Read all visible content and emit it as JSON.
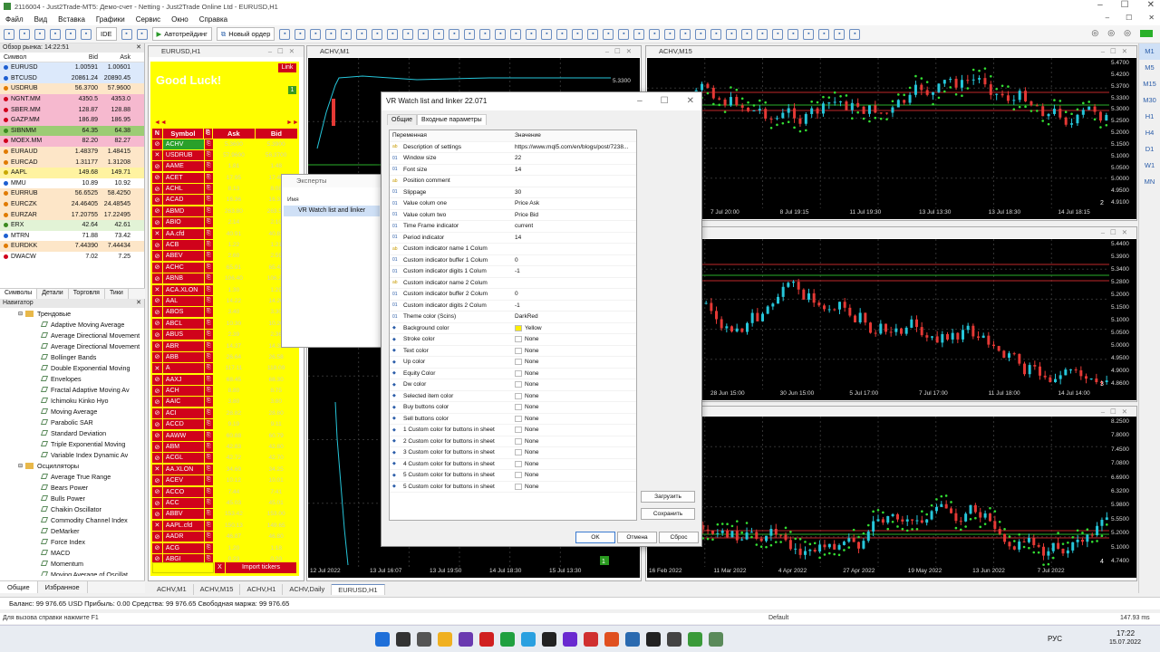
{
  "window": {
    "title": "2116004 - Just2Trade-MT5: Демо-счет - Netting - Just2Trade Online Ltd - EURUSD,H1"
  },
  "menu": [
    "Файл",
    "Вид",
    "Вставка",
    "Графики",
    "Сервис",
    "Окно",
    "Справка"
  ],
  "toolbar": {
    "ide": "IDE",
    "autotrade": "Автотрейдинг",
    "new_order": "Новый ордер"
  },
  "market_watch": {
    "title": "Обзор рынка: 14:22:51",
    "col_symbol": "Символ",
    "col_bid": "Bid",
    "col_ask": "Ask",
    "rows": [
      {
        "s": "EURUSD",
        "b": "1.00591",
        "a": "1.00601",
        "bg": "#dce9fb",
        "c": "#1d5fd1"
      },
      {
        "s": "BTCUSD",
        "b": "20861.24",
        "a": "20890.45",
        "bg": "#dce9fb",
        "c": "#1d5fd1"
      },
      {
        "s": "USDRUB",
        "b": "56.3700",
        "a": "57.9600",
        "bg": "#fde6c8",
        "c": "#e07a00"
      },
      {
        "s": "NGNT.MM",
        "b": "4350.5",
        "a": "4353.0",
        "bg": "#f6b9cf",
        "c": "#d0021b"
      },
      {
        "s": "SBER.MM",
        "b": "128.87",
        "a": "128.88",
        "bg": "#f6b9cf",
        "c": "#d0021b"
      },
      {
        "s": "GAZP.MM",
        "b": "186.89",
        "a": "186.95",
        "bg": "#f6b9cf",
        "c": "#d0021b"
      },
      {
        "s": "SIBNMM",
        "b": "64.35",
        "a": "64.38",
        "bg": "#9ccc74",
        "c": "#3a8a20"
      },
      {
        "s": "MOEX.MM",
        "b": "82.20",
        "a": "82.27",
        "bg": "#f6b9cf",
        "c": "#d0021b"
      },
      {
        "s": "EURAUD",
        "b": "1.48379",
        "a": "1.48415",
        "bg": "#fde6c8",
        "c": "#e07a00"
      },
      {
        "s": "EURCAD",
        "b": "1.31177",
        "a": "1.31208",
        "bg": "#fde6c8",
        "c": "#e07a00"
      },
      {
        "s": "AAPL",
        "b": "149.68",
        "a": "149.71",
        "bg": "#fff3a0",
        "c": "#c8a800"
      },
      {
        "s": "MMU",
        "b": "10.89",
        "a": "10.92",
        "bg": "#ffffff",
        "c": "#1d5fd1"
      },
      {
        "s": "EURRUB",
        "b": "56.6525",
        "a": "58.4250",
        "bg": "#fde6c8",
        "c": "#e07a00"
      },
      {
        "s": "EURCZK",
        "b": "24.46405",
        "a": "24.48545",
        "bg": "#fde6c8",
        "c": "#e07a00"
      },
      {
        "s": "EURZAR",
        "b": "17.20755",
        "a": "17.22495",
        "bg": "#fde6c8",
        "c": "#e07a00"
      },
      {
        "s": "ERX",
        "b": "42.64",
        "a": "42.61",
        "bg": "#e2f3d6",
        "c": "#3a8a20"
      },
      {
        "s": "MTRN",
        "b": "71.88",
        "a": "73.42",
        "bg": "#ffffff",
        "c": "#1d5fd1"
      },
      {
        "s": "EURDKK",
        "b": "7.44390",
        "a": "7.44434",
        "bg": "#fde6c8",
        "c": "#e07a00"
      },
      {
        "s": "DWACW",
        "b": "7.02",
        "a": "7.25",
        "bg": "#ffffff",
        "c": "#d0021b"
      }
    ],
    "tabs": [
      "Символы",
      "Детали",
      "Торговля",
      "Тики"
    ]
  },
  "navigator": {
    "title": "Навигатор",
    "items": [
      {
        "t": "Трендовые",
        "lvl": 1,
        "f": true
      },
      {
        "t": "Adaptive Moving Average",
        "lvl": 2
      },
      {
        "t": "Average Directional Movement",
        "lvl": 2
      },
      {
        "t": "Average Directional Movement",
        "lvl": 2
      },
      {
        "t": "Bollinger Bands",
        "lvl": 2
      },
      {
        "t": "Double Exponential Moving",
        "lvl": 2
      },
      {
        "t": "Envelopes",
        "lvl": 2
      },
      {
        "t": "Fractal Adaptive Moving Av",
        "lvl": 2
      },
      {
        "t": "Ichimoku Kinko Hyo",
        "lvl": 2
      },
      {
        "t": "Moving Average",
        "lvl": 2
      },
      {
        "t": "Parabolic SAR",
        "lvl": 2
      },
      {
        "t": "Standard Deviation",
        "lvl": 2
      },
      {
        "t": "Triple Exponential Moving",
        "lvl": 2
      },
      {
        "t": "Variable Index Dynamic Av",
        "lvl": 2
      },
      {
        "t": "Осцилляторы",
        "lvl": 1,
        "f": true
      },
      {
        "t": "Average True Range",
        "lvl": 2
      },
      {
        "t": "Bears Power",
        "lvl": 2
      },
      {
        "t": "Bulls Power",
        "lvl": 2
      },
      {
        "t": "Chaikin Oscillator",
        "lvl": 2
      },
      {
        "t": "Commodity Channel Index",
        "lvl": 2
      },
      {
        "t": "DeMarker",
        "lvl": 2
      },
      {
        "t": "Force Index",
        "lvl": 2
      },
      {
        "t": "MACD",
        "lvl": 2
      },
      {
        "t": "Momentum",
        "lvl": 2
      },
      {
        "t": "Moving Average of Oscillat",
        "lvl": 2
      }
    ],
    "tabs": [
      "Общие",
      "Избранное"
    ]
  },
  "eurusd_win": {
    "title": "EURUSD,H1",
    "good_luck": "Good Luck!",
    "link": "Link",
    "badge": "1",
    "head": [
      "N",
      "Symbol",
      "Ask",
      "Bid"
    ],
    "rows": [
      {
        "n": "⊘",
        "s": "ACHV",
        "a": "5.3600",
        "b": "5.3900",
        "sel": true
      },
      {
        "n": "✕",
        "s": "USDRUB",
        "a": "57.9600",
        "b": "56.3700"
      },
      {
        "n": "⊘",
        "s": "AAME",
        "a": "1.81",
        "b": "1.48"
      },
      {
        "n": "⊘",
        "s": "ACET",
        "a": "17.95",
        "b": "17.40"
      },
      {
        "n": "⊘",
        "s": "ACHL",
        "a": "8.13",
        "b": "8.08"
      },
      {
        "n": "⊘",
        "s": "ACAD",
        "a": "16.36",
        "b": "16.31"
      },
      {
        "n": "⊘",
        "s": "ABMD",
        "a": "263.80",
        "b": "263.50"
      },
      {
        "n": "⊘",
        "s": "ABIO",
        "a": "2.14",
        "b": "2.10"
      },
      {
        "n": "✕",
        "s": "AA.cfd",
        "a": "40.91",
        "b": "40.81"
      },
      {
        "n": "⊘",
        "s": "ACB",
        "a": "1.22",
        "b": "1.21"
      },
      {
        "n": "⊘",
        "s": "ABEV",
        "a": "2.60",
        "b": "2.59"
      },
      {
        "n": "⊘",
        "s": "ACHC",
        "a": "65.91",
        "b": "65.42"
      },
      {
        "n": "⊘",
        "s": "ABNB",
        "a": "106.40",
        "b": "106.20"
      },
      {
        "n": "✕",
        "s": "ACA.XLON",
        "a": "1.30",
        "b": "1.29"
      },
      {
        "n": "⊘",
        "s": "AAL",
        "a": "14.22",
        "b": "14.20"
      },
      {
        "n": "⊘",
        "s": "ABOS",
        "a": "3.40",
        "b": "3.30"
      },
      {
        "n": "⊘",
        "s": "ABCL",
        "a": "10.30",
        "b": "10.20"
      },
      {
        "n": "⊘",
        "s": "ABUS",
        "a": "2.39",
        "b": "2.36"
      },
      {
        "n": "⊘",
        "s": "ABR",
        "a": "14.37",
        "b": "14.33"
      },
      {
        "n": "⊘",
        "s": "ABB",
        "a": "26.64",
        "b": "26.58"
      },
      {
        "n": "✕",
        "s": "A",
        "a": "117.11",
        "b": "118.09"
      },
      {
        "n": "⊘",
        "s": "AAXJ",
        "a": "68.45",
        "b": "68.30"
      },
      {
        "n": "⊘",
        "s": "ACH",
        "a": "8.80",
        "b": "8.75"
      },
      {
        "n": "⊘",
        "s": "AAIC",
        "a": "3.80",
        "b": "3.80"
      },
      {
        "n": "⊘",
        "s": "ACI",
        "a": "28.82",
        "b": "28.80"
      },
      {
        "n": "⊘",
        "s": "ACCD",
        "a": "9.19",
        "b": "9.11"
      },
      {
        "n": "⊘",
        "s": "AAWW",
        "a": "60.88",
        "b": "60.79"
      },
      {
        "n": "⊘",
        "s": "ABM",
        "a": "42.83",
        "b": "42.80"
      },
      {
        "n": "⊘",
        "s": "ACGL",
        "a": "42.72",
        "b": "42.70"
      },
      {
        "n": "✕",
        "s": "AA.XLON",
        "a": "34.60",
        "b": "34.25"
      },
      {
        "n": "⊘",
        "s": "ACEV",
        "a": "10.12",
        "b": "10.01"
      },
      {
        "n": "⊘",
        "s": "ACCO",
        "a": "7.44",
        "b": "7.41"
      },
      {
        "n": "⊘",
        "s": "ACC",
        "a": "45.03",
        "b": "45.01"
      },
      {
        "n": "⊘",
        "s": "ABBV",
        "a": "153.42",
        "b": "153.00"
      },
      {
        "n": "✕",
        "s": "AAPL.cfd",
        "a": "150.13",
        "b": "149.65"
      },
      {
        "n": "⊘",
        "s": "AADR",
        "a": "46.87",
        "b": "46.80"
      },
      {
        "n": "⊘",
        "s": "ACG",
        "a": "1.20",
        "b": "1.18"
      },
      {
        "n": "⊘",
        "s": "ABGI",
        "a": "0.23",
        "b": "0.20"
      }
    ],
    "foot_x": "X",
    "foot_import": "Import tickers"
  },
  "experts": {
    "title": "Эксперты",
    "col": "Имя",
    "item": "VR Watch list and linker"
  },
  "achv_m1": {
    "title": "ACHV,M1",
    "price": "5.3300",
    "dates": [
      "12 Jul 2022",
      "13 Jul 16:07",
      "13 Jul 19:50",
      "14 Jul 18:30",
      "15 Jul 13:30"
    ],
    "badge": "1"
  },
  "achv_m15": {
    "title": "ACHV,M15",
    "prices": [
      "5.4700",
      "5.4200",
      "5.3700",
      "5.3300",
      "5.3000",
      "5.2500",
      "5.2000",
      "5.1500",
      "5.1000",
      "5.0500",
      "5.0000",
      "4.9500",
      "4.9100"
    ],
    "dates": [
      "7 Jul 20:00",
      "8 Jul 19:15",
      "11 Jul 19:30",
      "13 Jul 13:30",
      "13 Jul 18:30",
      "14 Jul 18:15"
    ],
    "badge": "2"
  },
  "achv_h1": {
    "prices": [
      "5.4400",
      "5.3900",
      "5.3400",
      "5.2800",
      "5.2000",
      "5.1500",
      "5.1000",
      "5.0500",
      "5.0000",
      "4.9500",
      "4.9000",
      "4.8600"
    ],
    "dates": [
      "28 Jun 15:00",
      "30 Jun 15:00",
      "5 Jul 17:00",
      "7 Jul 17:00",
      "11 Jul 18:00",
      "14 Jul 14:00"
    ],
    "badge": "3"
  },
  "achv_daily": {
    "prices": [
      "8.2500",
      "7.8000",
      "7.4500",
      "7.0800",
      "6.6900",
      "6.3200",
      "5.9800",
      "5.5500",
      "5.2000",
      "5.1000",
      "4.7400"
    ],
    "dates": [
      "16 Feb 2022",
      "11 Mar 2022",
      "4 Apr 2022",
      "27 Apr 2022",
      "19 May 2022",
      "13 Jun 2022",
      "7 Jul 2022"
    ],
    "badge": "4"
  },
  "dialog": {
    "title": "VR Watch list and linker 22.071",
    "tabs": [
      "Общие",
      "Входные параметры"
    ],
    "col_var": "Переменная",
    "col_val": "Значение",
    "params": [
      {
        "i": "ab",
        "n": "Description of settings",
        "v": "https://www.mql5.com/en/blogs/post/7238..."
      },
      {
        "i": "01",
        "n": "Window size",
        "v": "22"
      },
      {
        "i": "01",
        "n": "Font size",
        "v": "14"
      },
      {
        "i": "ab",
        "n": "Position comment",
        "v": ""
      },
      {
        "i": "01",
        "n": "Slippage",
        "v": "30"
      },
      {
        "i": "01",
        "n": "Value colum one",
        "v": "Price Ask"
      },
      {
        "i": "01",
        "n": "Value colum two",
        "v": "Price Bid"
      },
      {
        "i": "01",
        "n": "Time Frame indicator",
        "v": "current"
      },
      {
        "i": "01",
        "n": "Period indicator",
        "v": "14"
      },
      {
        "i": "ab",
        "n": "Custom indicator name   1 Colum",
        "v": ""
      },
      {
        "i": "01",
        "n": "Custom indicator buffer 1 Colum",
        "v": "0"
      },
      {
        "i": "01",
        "n": "Custom indicator digits 1 Colum",
        "v": "-1"
      },
      {
        "i": "ab",
        "n": "Custom indicator name   2 Colum",
        "v": ""
      },
      {
        "i": "01",
        "n": "Custom indicator buffer 2 Colum",
        "v": "0"
      },
      {
        "i": "01",
        "n": "Custom indicator digits 2 Colum",
        "v": "-1"
      },
      {
        "i": "01",
        "n": "Theme color (Scins)",
        "v": "DarkRed"
      },
      {
        "i": "c",
        "n": "Background color",
        "v": "Yellow",
        "sw": "#ffee00"
      },
      {
        "i": "c",
        "n": "Stroke color",
        "v": "None",
        "sw": "#ffffff"
      },
      {
        "i": "c",
        "n": "Text color",
        "v": "None",
        "sw": "#ffffff"
      },
      {
        "i": "c",
        "n": "Up color",
        "v": "None",
        "sw": "#ffffff"
      },
      {
        "i": "c",
        "n": "Equity Color",
        "v": "None",
        "sw": "#ffffff"
      },
      {
        "i": "c",
        "n": "Dw color",
        "v": "None",
        "sw": "#ffffff"
      },
      {
        "i": "c",
        "n": "Selected item color",
        "v": "None",
        "sw": "#ffffff"
      },
      {
        "i": "c",
        "n": "Buy buttons color",
        "v": "None",
        "sw": "#ffffff"
      },
      {
        "i": "c",
        "n": "Sell buttons color",
        "v": "None",
        "sw": "#ffffff"
      },
      {
        "i": "c",
        "n": "1 Custom color for buttons in sheet",
        "v": "None",
        "sw": "#ffffff"
      },
      {
        "i": "c",
        "n": "2 Custom color for buttons in sheet",
        "v": "None",
        "sw": "#ffffff"
      },
      {
        "i": "c",
        "n": "3 Custom color for buttons in sheet",
        "v": "None",
        "sw": "#ffffff"
      },
      {
        "i": "c",
        "n": "4 Custom color for buttons in sheet",
        "v": "None",
        "sw": "#ffffff"
      },
      {
        "i": "c",
        "n": "5 Custom color for buttons in sheet",
        "v": "None",
        "sw": "#ffffff"
      },
      {
        "i": "c",
        "n": "5 Custom color for buttons in sheet",
        "v": "None",
        "sw": "#ffffff"
      }
    ],
    "load": "Загрузить",
    "save": "Сохранить",
    "ok": "OK",
    "cancel": "Отмена",
    "reset": "Сброс"
  },
  "timeframes": [
    "M1",
    "M5",
    "M15",
    "M30",
    "H1",
    "H4",
    "D1",
    "W1",
    "MN"
  ],
  "chart_tabs": [
    "ACHV,M1",
    "ACHV,M15",
    "ACHV,H1",
    "ACHV,Daily",
    "EURUSD,H1"
  ],
  "status": {
    "balance": "Баланс: 99 976.65 USD  Прибыль: 0.00  Средства: 99 976.65  Свободная маржа: 99 976.65"
  },
  "help": {
    "text": "Для вызова справки нажмите F1",
    "profile": "Default",
    "ping": "147.93 ms"
  },
  "taskbar": {
    "lang": "РУС",
    "time": "17:22",
    "date": "15.07.2022"
  }
}
